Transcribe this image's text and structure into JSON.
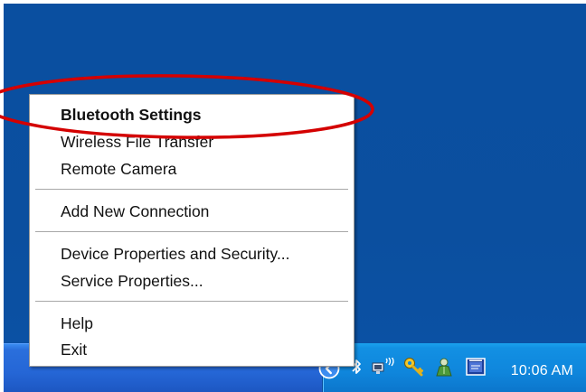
{
  "menu": {
    "items": [
      {
        "label": "Bluetooth Settings"
      },
      {
        "label": "Wireless File Transfer"
      },
      {
        "label": "Remote Camera"
      },
      {
        "label": "Add New Connection"
      },
      {
        "label": "Device Properties and Security..."
      },
      {
        "label": "Service Properties..."
      },
      {
        "label": "Help"
      },
      {
        "label": "Exit"
      }
    ]
  },
  "taskbar": {
    "tray_icons": [
      "show-hidden-icons-chevron-icon",
      "bluetooth-icon",
      "wireless-network-icon",
      "key-icon",
      "user-icon",
      "app-window-icon"
    ],
    "clock": "10:06 AM"
  },
  "colors": {
    "desktop": "#0b4f9f",
    "taskbar": "#2566d6",
    "tray": "#0f86dc",
    "annotation": "#d40000"
  }
}
